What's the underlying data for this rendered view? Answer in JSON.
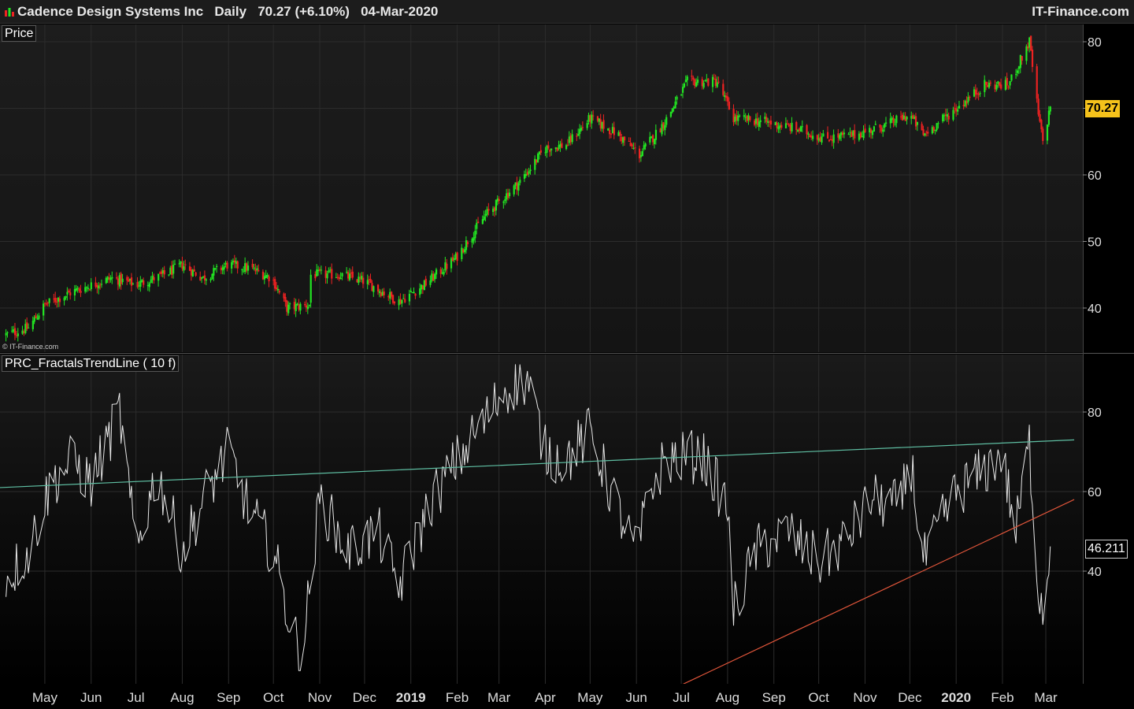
{
  "header": {
    "instrument": "Cadence Design Systems Inc",
    "period": "Daily",
    "last": "70.27 (+6.10%)",
    "date": "04-Mar-2020",
    "brand": "IT-Finance.com"
  },
  "price_panel": {
    "label": "Price",
    "last_tag": "70.27",
    "copyright": "© IT-Finance.com"
  },
  "indicator_panel": {
    "label": "PRC_FractalsTrendLine ( 10 f)",
    "last_tag": "46.211"
  },
  "colors": {
    "up": "#22e622",
    "down": "#ee2222",
    "line": "#e8e8e8",
    "upper_trend": "#5fbfa3",
    "lower_trend": "#e0553a",
    "grid": "#2c2c2c",
    "tag_price": "#f5c21b"
  },
  "chart_data": [
    {
      "type": "candlestick",
      "title": "Price",
      "x_tick_labels": [
        "May",
        "Jun",
        "Jul",
        "Aug",
        "Sep",
        "Oct",
        "Nov",
        "Dec",
        "2019",
        "Feb",
        "Mar",
        "Apr",
        "May",
        "Jun",
        "Jul",
        "Aug",
        "Sep",
        "Oct",
        "Nov",
        "Dec",
        "2020",
        "Feb",
        "Mar"
      ],
      "y_tick_labels": [
        40,
        50,
        60,
        70,
        80
      ],
      "ylim": [
        33,
        82
      ],
      "last_value": 70.27,
      "approx_close_path": [
        [
          "2018-04-05",
          36
        ],
        [
          "2018-04-20",
          37
        ],
        [
          "2018-05-01",
          40.5
        ],
        [
          "2018-05-20",
          42.5
        ],
        [
          "2018-06-15",
          44.5
        ],
        [
          "2018-07-01",
          43.5
        ],
        [
          "2018-07-20",
          45
        ],
        [
          "2018-08-01",
          46.5
        ],
        [
          "2018-08-15",
          44.5
        ],
        [
          "2018-08-31",
          46.5
        ],
        [
          "2018-09-15",
          46
        ],
        [
          "2018-09-30",
          44.5
        ],
        [
          "2018-10-10",
          40
        ],
        [
          "2018-10-25",
          40.5
        ],
        [
          "2018-10-26",
          45
        ],
        [
          "2018-11-15",
          45
        ],
        [
          "2018-12-01",
          44
        ],
        [
          "2018-12-24",
          41
        ],
        [
          "2019-01-10",
          43.5
        ],
        [
          "2019-01-31",
          47.5
        ],
        [
          "2019-02-20",
          54
        ],
        [
          "2019-03-15",
          59
        ],
        [
          "2019-04-01",
          64
        ],
        [
          "2019-04-15",
          64.5
        ],
        [
          "2019-05-01",
          68.5
        ],
        [
          "2019-05-20",
          66
        ],
        [
          "2019-06-03",
          63
        ],
        [
          "2019-06-20",
          68
        ],
        [
          "2019-07-05",
          74
        ],
        [
          "2019-07-25",
          74
        ],
        [
          "2019-08-05",
          68.5
        ],
        [
          "2019-08-25",
          68
        ],
        [
          "2019-09-15",
          67
        ],
        [
          "2019-10-05",
          65.5
        ],
        [
          "2019-10-25",
          66
        ],
        [
          "2019-11-15",
          67.5
        ],
        [
          "2019-12-01",
          69
        ],
        [
          "2019-12-10",
          66
        ],
        [
          "2020-01-01",
          70
        ],
        [
          "2020-01-20",
          73.5
        ],
        [
          "2020-02-05",
          73.5
        ],
        [
          "2020-02-19",
          80
        ],
        [
          "2020-02-25",
          69
        ],
        [
          "2020-02-28",
          65
        ],
        [
          "2020-03-04",
          70.27
        ]
      ]
    },
    {
      "type": "line",
      "title": "PRC_FractalsTrendLine ( 10 f)",
      "y_tick_labels": [
        40,
        60,
        80
      ],
      "ylim": [
        13,
        93
      ],
      "last_value": 46.211,
      "series": [
        {
          "values_approx": [
            [
              "2018-04-05",
              38
            ],
            [
              "2018-04-20",
              45
            ],
            [
              "2018-05-05",
              62
            ],
            [
              "2018-05-20",
              68
            ],
            [
              "2018-06-01",
              62
            ],
            [
              "2018-06-20",
              80
            ],
            [
              "2018-07-01",
              45
            ],
            [
              "2018-07-15",
              65
            ],
            [
              "2018-08-01",
              45
            ],
            [
              "2018-08-15",
              58
            ],
            [
              "2018-09-01",
              70
            ],
            [
              "2018-09-15",
              55
            ],
            [
              "2018-10-01",
              45
            ],
            [
              "2018-10-10",
              30
            ],
            [
              "2018-10-20",
              18
            ],
            [
              "2018-11-01",
              58
            ],
            [
              "2018-11-20",
              45
            ],
            [
              "2018-12-10",
              50
            ],
            [
              "2018-12-24",
              36
            ],
            [
              "2019-01-15",
              58
            ],
            [
              "2019-02-05",
              70
            ],
            [
              "2019-02-20",
              78
            ],
            [
              "2019-03-05",
              86
            ],
            [
              "2019-03-20",
              88
            ],
            [
              "2019-04-01",
              70
            ],
            [
              "2019-04-15",
              68
            ],
            [
              "2019-05-01",
              75
            ],
            [
              "2019-05-15",
              60
            ],
            [
              "2019-06-01",
              44
            ],
            [
              "2019-06-10",
              60
            ],
            [
              "2019-06-20",
              68
            ],
            [
              "2019-07-15",
              69
            ],
            [
              "2019-08-01",
              56
            ],
            [
              "2019-08-05",
              30
            ],
            [
              "2019-08-20",
              45
            ],
            [
              "2019-09-10",
              50
            ],
            [
              "2019-10-01",
              42
            ],
            [
              "2019-10-20",
              48
            ],
            [
              "2019-11-05",
              58
            ],
            [
              "2019-11-25",
              56
            ],
            [
              "2019-12-01",
              70
            ],
            [
              "2019-12-10",
              42
            ],
            [
              "2020-01-01",
              60
            ],
            [
              "2020-01-20",
              65
            ],
            [
              "2020-01-31",
              70
            ],
            [
              "2020-02-10",
              50
            ],
            [
              "2020-02-19",
              72
            ],
            [
              "2020-02-24",
              40
            ],
            [
              "2020-02-28",
              30
            ],
            [
              "2020-03-04",
              46.211
            ]
          ]
        }
      ],
      "trendlines": [
        {
          "name": "upper",
          "from": [
            "2018-04-01",
            61
          ],
          "to": [
            "2020-03-20",
            73
          ]
        },
        {
          "name": "lower",
          "from": [
            "2019-05-26",
            5
          ],
          "to": [
            "2020-03-20",
            58
          ]
        }
      ]
    }
  ]
}
